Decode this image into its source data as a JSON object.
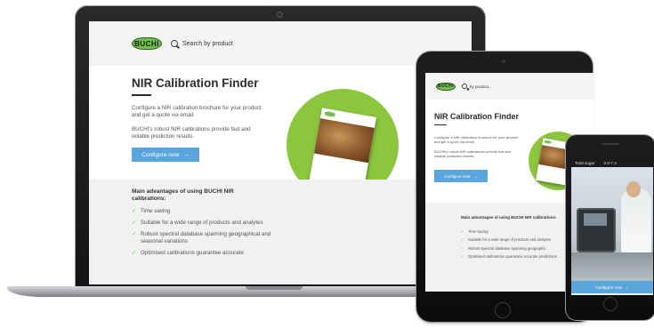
{
  "brand": {
    "logo_text": "BUCHI",
    "accent": "#6cc24a",
    "button_color": "#5aa6dc"
  },
  "laptop": {
    "search_label": "Search by product",
    "title": "NIR Calibration Finder",
    "intro": "Configure a NIR calibration brochure for your product and get a quote via email.",
    "intro2": "BUCHI's robust NIR calibrations provide fast and reliable prediction results.",
    "cta_label": "Configure now",
    "advantages_heading": "Main advantages of using BUCHI NIR calibrations:",
    "advantages": [
      "Time saving",
      "Suitable for a wide range of products and analytes",
      "Robust spectral database spanning geographical and seasonal variations",
      "Optimised calibrations guarantee accurate"
    ]
  },
  "tablet": {
    "search_label": "by product...",
    "title": "NIR Calibration Finder",
    "intro": "Configure a NIR calibration brochure for your product and get a quote via email.",
    "intro2": "BUCHI's robust NIR calibrations provide fast and reliable prediction results.",
    "cta_label": "Configure now",
    "advantages_heading": "Main advantages of using BUCHI NIR calibrations:",
    "advantages": [
      "Time saving",
      "Suitable for a wide range of products and analytes",
      "Robust spectral database spanning geographic",
      "Optimised calibrations guarantee accurate predictions"
    ]
  },
  "phone": {
    "status_left": "Total sugar",
    "status_right": "0.0-7.4",
    "cta_label": "Configure now"
  }
}
